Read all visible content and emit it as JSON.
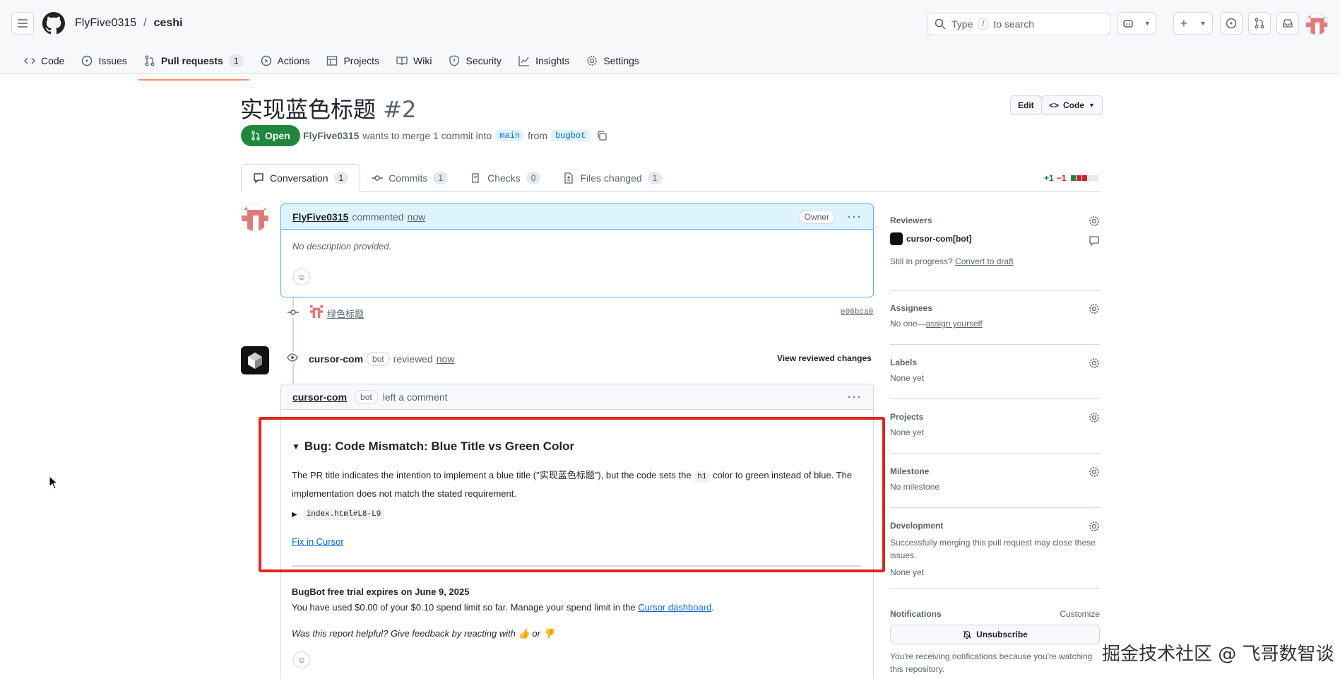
{
  "header": {
    "owner": "FlyFive0315",
    "separator": "/",
    "repo": "ceshi",
    "search_type": "Type",
    "search_key": "/",
    "search_rest": "to search"
  },
  "nav": [
    {
      "label": "Code",
      "icon": "code-icon"
    },
    {
      "label": "Issues",
      "icon": "issue-icon"
    },
    {
      "label": "Pull requests",
      "icon": "pr-icon",
      "count": "1",
      "active": true
    },
    {
      "label": "Actions",
      "icon": "play-icon"
    },
    {
      "label": "Projects",
      "icon": "table-icon"
    },
    {
      "label": "Wiki",
      "icon": "book-icon"
    },
    {
      "label": "Security",
      "icon": "shield-icon"
    },
    {
      "label": "Insights",
      "icon": "graph-icon"
    },
    {
      "label": "Settings",
      "icon": "gear-icon"
    }
  ],
  "pr": {
    "title": "实现蓝色标题",
    "number": "#2",
    "edit_label": "Edit",
    "code_label": "Code",
    "state": "Open",
    "author": "FlyFive0315",
    "meta_text": "wants to merge 1 commit into",
    "base": "main",
    "from_text": "from",
    "head": "bugbot"
  },
  "tabs": [
    {
      "label": "Conversation",
      "count": "1",
      "active": true
    },
    {
      "label": "Commits",
      "count": "1"
    },
    {
      "label": "Checks",
      "count": "0"
    },
    {
      "label": "Files changed",
      "count": "1"
    }
  ],
  "diffstat": {
    "plus": "+1",
    "minus": "−1"
  },
  "comment1": {
    "author": "FlyFive0315",
    "action": "commented",
    "time": "now",
    "badge": "Owner",
    "body": "No description provided."
  },
  "commit": {
    "message": "绿色标题",
    "sha": "e06bca0"
  },
  "review": {
    "author": "cursor-com",
    "bot": "bot",
    "action": "reviewed",
    "time": "now",
    "view_changes": "View reviewed changes"
  },
  "comment2": {
    "author": "cursor-com",
    "bot": "bot",
    "action": "left a comment",
    "bug_title": "Bug: Code Mismatch: Blue Title vs Green Color",
    "bug_text_1": "The PR title indicates the intention to implement a blue title (\"实现蓝色标题\"), but the code sets the",
    "bug_code": "h1",
    "bug_text_2": "color to green instead of",
    "bug_text_3": "blue. The implementation does not match the stated requirement.",
    "file_ref": "index.html#L8-L9",
    "fix_link": "Fix in Cursor",
    "trial_title": "BugBot free trial expires on June 9, 2025",
    "trial_text": "You have used $0.00 of your $0.10 spend limit so far. Manage your spend limit in the",
    "dashboard_link": "Cursor dashboard",
    "trial_end": ".",
    "feedback": "Was this report helpful? Give feedback by reacting with 👍 or 👎"
  },
  "sidebar": {
    "reviewers_title": "Reviewers",
    "reviewer": "cursor-com[bot]",
    "still_in_progress": "Still in progress?",
    "convert_draft": "Convert to draft",
    "assignees_title": "Assignees",
    "assignees_none": "No one—",
    "assign_yourself": "assign yourself",
    "labels_title": "Labels",
    "labels_val": "None yet",
    "projects_title": "Projects",
    "projects_val": "None yet",
    "milestone_title": "Milestone",
    "milestone_val": "No milestone",
    "development_title": "Development",
    "development_text": "Successfully merging this pull request may close these issues.",
    "development_val": "None yet",
    "notifications_title": "Notifications",
    "customize": "Customize",
    "unsubscribe": "Unsubscribe",
    "notif_text": "You're receiving notifications because you're watching this repository."
  },
  "watermark": "掘金技术社区 @ 飞哥数智谈"
}
